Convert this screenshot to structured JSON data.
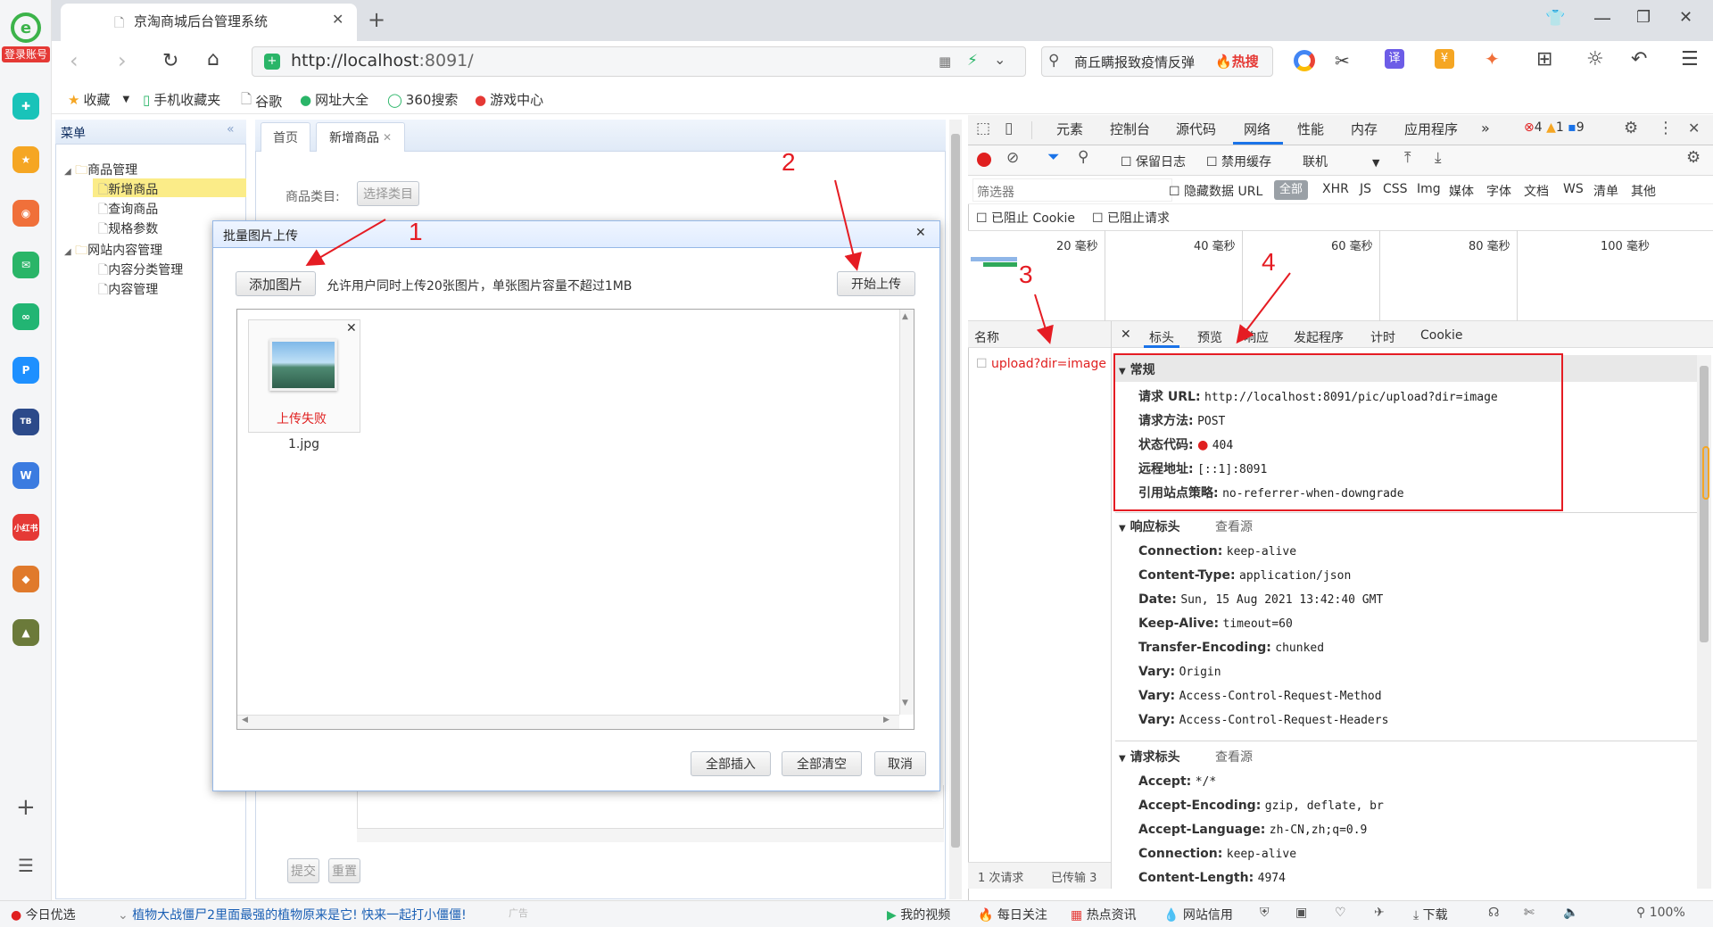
{
  "left_sidebar": {
    "login_label": "登录账号",
    "apps": [
      "shortcut-icon",
      "favorites-icon",
      "weibo-icon",
      "mail-icon",
      "link-icon",
      "p-icon",
      "game-icon",
      "doc-icon",
      "xiaohongshu-icon",
      "game2-icon",
      "game3-icon"
    ]
  },
  "browser": {
    "tab_title": "京淘商城后台管理系统",
    "url": "http://localhost:8091/",
    "url_host": "http://localhost",
    "url_rest": ":8091/",
    "search_placeholder": "商丘瞒报致疫情反弹",
    "hot_label": "热搜",
    "bookmarks": [
      "收藏",
      "手机收藏夹",
      "谷歌",
      "网址大全",
      "360搜索",
      "游戏中心"
    ]
  },
  "admin": {
    "menu_title": "菜单",
    "tree": {
      "group1": "商品管理",
      "items1": [
        "新增商品",
        "查询商品",
        "规格参数"
      ],
      "group2": "网站内容管理",
      "items2": [
        "内容分类管理",
        "内容管理"
      ]
    },
    "tabs": [
      "首页",
      "新增商品"
    ],
    "category_label": "商品类目:",
    "category_button": "选择类目",
    "submit": "提交",
    "reset": "重置"
  },
  "dialog": {
    "title": "批量图片上传",
    "add_button": "添加图片",
    "hint": "允许用户同时上传20张图片，单张图片容量不超过1MB",
    "start_button": "开始上传",
    "thumb_status": "上传失败",
    "thumb_name": "1.jpg",
    "insert_all": "全部插入",
    "clear_all": "全部清空",
    "cancel": "取消"
  },
  "devtools": {
    "tabs": [
      "元素",
      "控制台",
      "源代码",
      "网络",
      "性能",
      "内存",
      "应用程序"
    ],
    "active_tab": "网络",
    "errors": "4",
    "warnings": "1",
    "messages": "9",
    "preserve_log": "保留日志",
    "disable_cache": "禁用缓存",
    "throttle": "联机",
    "filter_placeholder": "筛选器",
    "hide_data_urls": "隐藏数据 URL",
    "filter_types": [
      "全部",
      "XHR",
      "JS",
      "CSS",
      "Img",
      "媒体",
      "字体",
      "文档",
      "WS",
      "清单",
      "其他"
    ],
    "blocked_cookies": "已阻止 Cookie",
    "blocked_requests": "已阻止请求",
    "timeline": [
      "20 毫秒",
      "40 毫秒",
      "60 毫秒",
      "80 毫秒",
      "100 毫秒"
    ],
    "name_header": "名称",
    "request_name": "upload?dir=image",
    "detail_tabs": [
      "标头",
      "预览",
      "响应",
      "发起程序",
      "计时",
      "Cookie"
    ],
    "general": {
      "title": "常规",
      "rows": [
        {
          "k": "请求 URL:",
          "v": "http://localhost:8091/pic/upload?dir=image"
        },
        {
          "k": "请求方法:",
          "v": "POST"
        },
        {
          "k": "状态代码:",
          "v": "404"
        },
        {
          "k": "远程地址:",
          "v": "[::1]:8091"
        },
        {
          "k": "引用站点策略:",
          "v": "no-referrer-when-downgrade"
        }
      ]
    },
    "response_headers": {
      "title": "响应标头",
      "view_source": "查看源",
      "rows": [
        {
          "k": "Connection:",
          "v": "keep-alive"
        },
        {
          "k": "Content-Type:",
          "v": "application/json"
        },
        {
          "k": "Date:",
          "v": "Sun, 15 Aug 2021 13:42:40 GMT"
        },
        {
          "k": "Keep-Alive:",
          "v": "timeout=60"
        },
        {
          "k": "Transfer-Encoding:",
          "v": "chunked"
        },
        {
          "k": "Vary:",
          "v": "Origin"
        },
        {
          "k": "Vary:",
          "v": "Access-Control-Request-Method"
        },
        {
          "k": "Vary:",
          "v": "Access-Control-Request-Headers"
        }
      ]
    },
    "request_headers": {
      "title": "请求标头",
      "view_source": "查看源",
      "rows": [
        {
          "k": "Accept:",
          "v": "*/*"
        },
        {
          "k": "Accept-Encoding:",
          "v": "gzip, deflate, br"
        },
        {
          "k": "Accept-Language:",
          "v": "zh-CN,zh;q=0.9"
        },
        {
          "k": "Connection:",
          "v": "keep-alive"
        },
        {
          "k": "Content-Length:",
          "v": "4974"
        }
      ]
    },
    "footer_requests": "1 次请求",
    "footer_transferred": "已传输 3"
  },
  "annotations": [
    "1",
    "2",
    "3",
    "4"
  ],
  "statusbar": {
    "left": "今日优选",
    "news": "植物大战僵尸2里面最强的植物原来是它! 快来一起打小僵僵!",
    "ad": "广告",
    "items": [
      "我的视频",
      "每日关注",
      "热点资讯",
      "网站信用",
      "下载"
    ],
    "zoom": "100%"
  },
  "colors": {
    "accent": "#1a73e8",
    "error": "#e02020",
    "annotation": "#e51c23"
  }
}
